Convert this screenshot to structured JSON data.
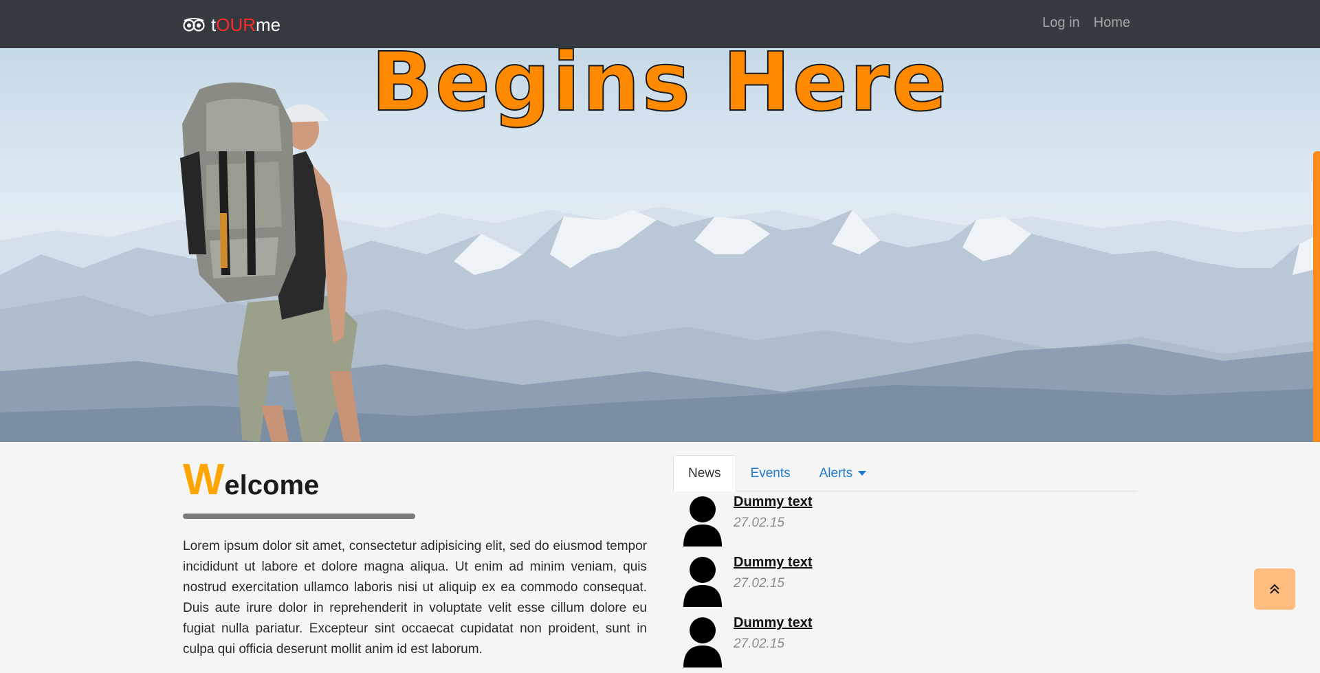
{
  "navbar": {
    "brand_prefix": "t",
    "brand_highlight": "OUR",
    "brand_suffix": "me",
    "brand_icon": "owl-eyes-icon",
    "links": [
      {
        "label": "Log in"
      },
      {
        "label": "Home"
      }
    ]
  },
  "hero": {
    "title": "Begins Here"
  },
  "welcome": {
    "first_letter": "W",
    "rest": "elcome",
    "body": "Lorem ipsum dolor sit amet, consectetur adipisicing elit, sed do eiusmod tempor incididunt ut labore et dolore magna aliqua. Ut enim ad minim veniam, quis nostrud exercitation ullamco laboris nisi ut aliquip ex ea commodo consequat. Duis aute irure dolor in reprehenderit in voluptate velit esse cillum dolore eu fugiat nulla pariatur. Excepteur sint occaecat cupidatat non proident, sunt in culpa qui officia deserunt mollit anim id est laborum."
  },
  "tabs": [
    {
      "label": "News",
      "active": true
    },
    {
      "label": "Events",
      "active": false
    },
    {
      "label": "Alerts",
      "active": false
    }
  ],
  "news": [
    {
      "title": "Dummy text",
      "date": "27.02.15"
    },
    {
      "title": "Dummy text",
      "date": "27.02.15"
    },
    {
      "title": "Dummy text",
      "date": "27.02.15"
    }
  ],
  "colors": {
    "navbar_bg": "#343a40",
    "accent_orange": "#ff8a00",
    "brand_red": "#ff2a2a",
    "link_blue": "#1e7ad0"
  },
  "icons": {
    "back_to_top": "double-chevron-up-icon",
    "avatar": "user-avatar-icon"
  }
}
